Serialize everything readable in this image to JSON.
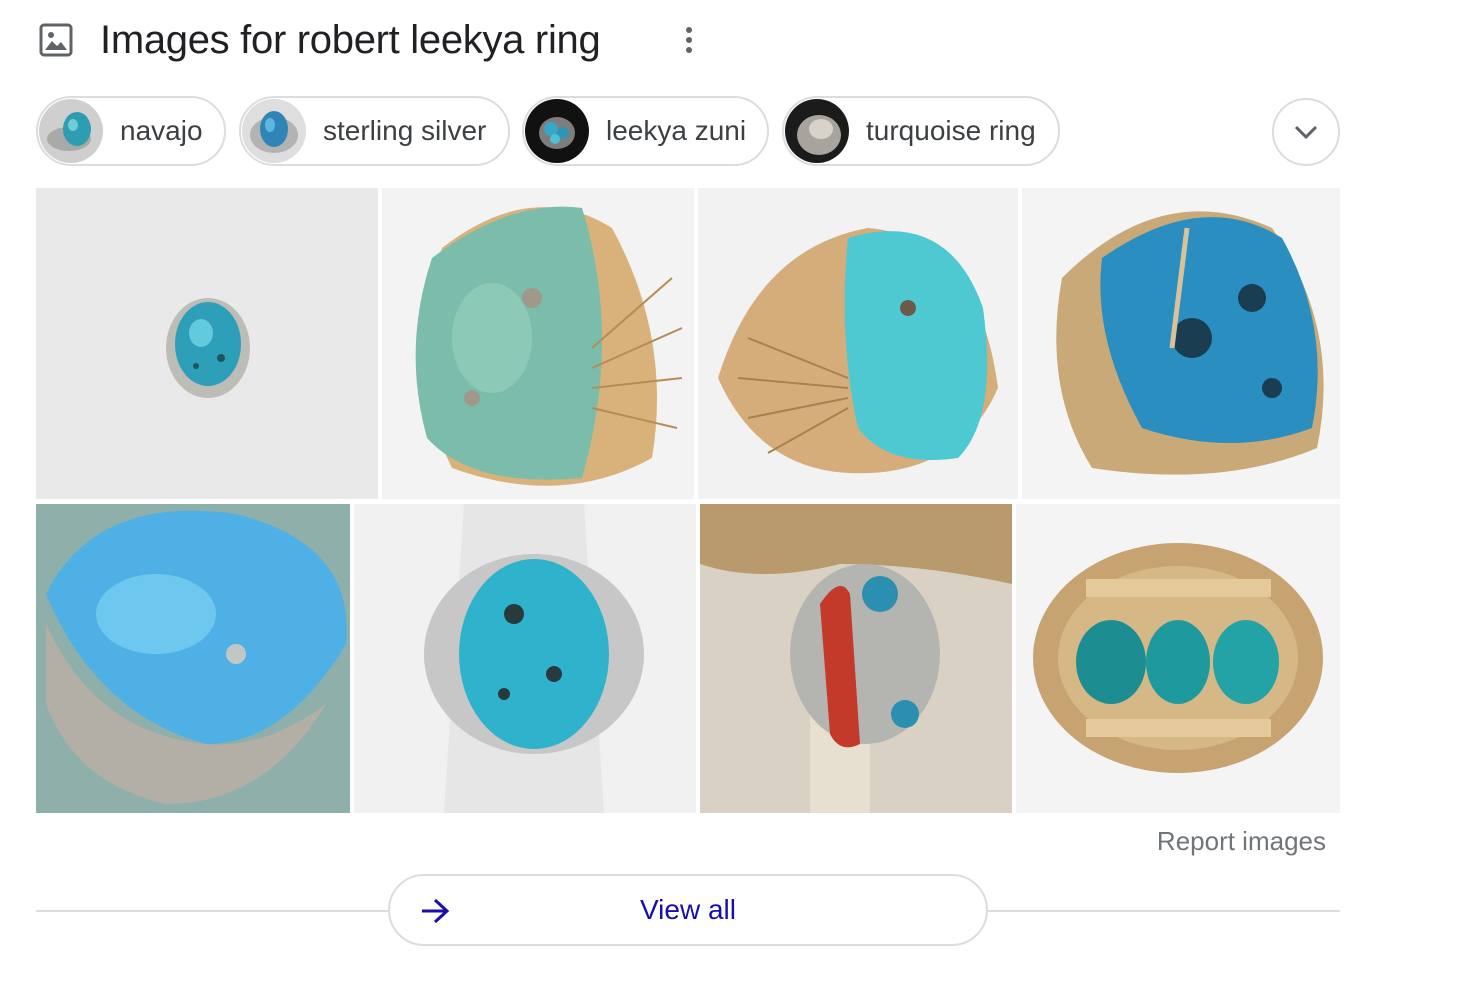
{
  "header": {
    "title": "Images for robert leekya ring",
    "image_icon": "image-icon",
    "more_icon": "more-vert-icon"
  },
  "chips": [
    {
      "label": "navajo"
    },
    {
      "label": "sterling silver"
    },
    {
      "label": "leekya zuni"
    },
    {
      "label": "turquoise ring"
    }
  ],
  "expand_icon": "chevron-down-icon",
  "report_label": "Report images",
  "view_all": {
    "label": "View all",
    "icon": "arrow-right-icon"
  },
  "colors": {
    "title": "#202124",
    "chip_border": "#dadce0",
    "link_blue": "#1a0dab",
    "muted": "#70757a"
  }
}
